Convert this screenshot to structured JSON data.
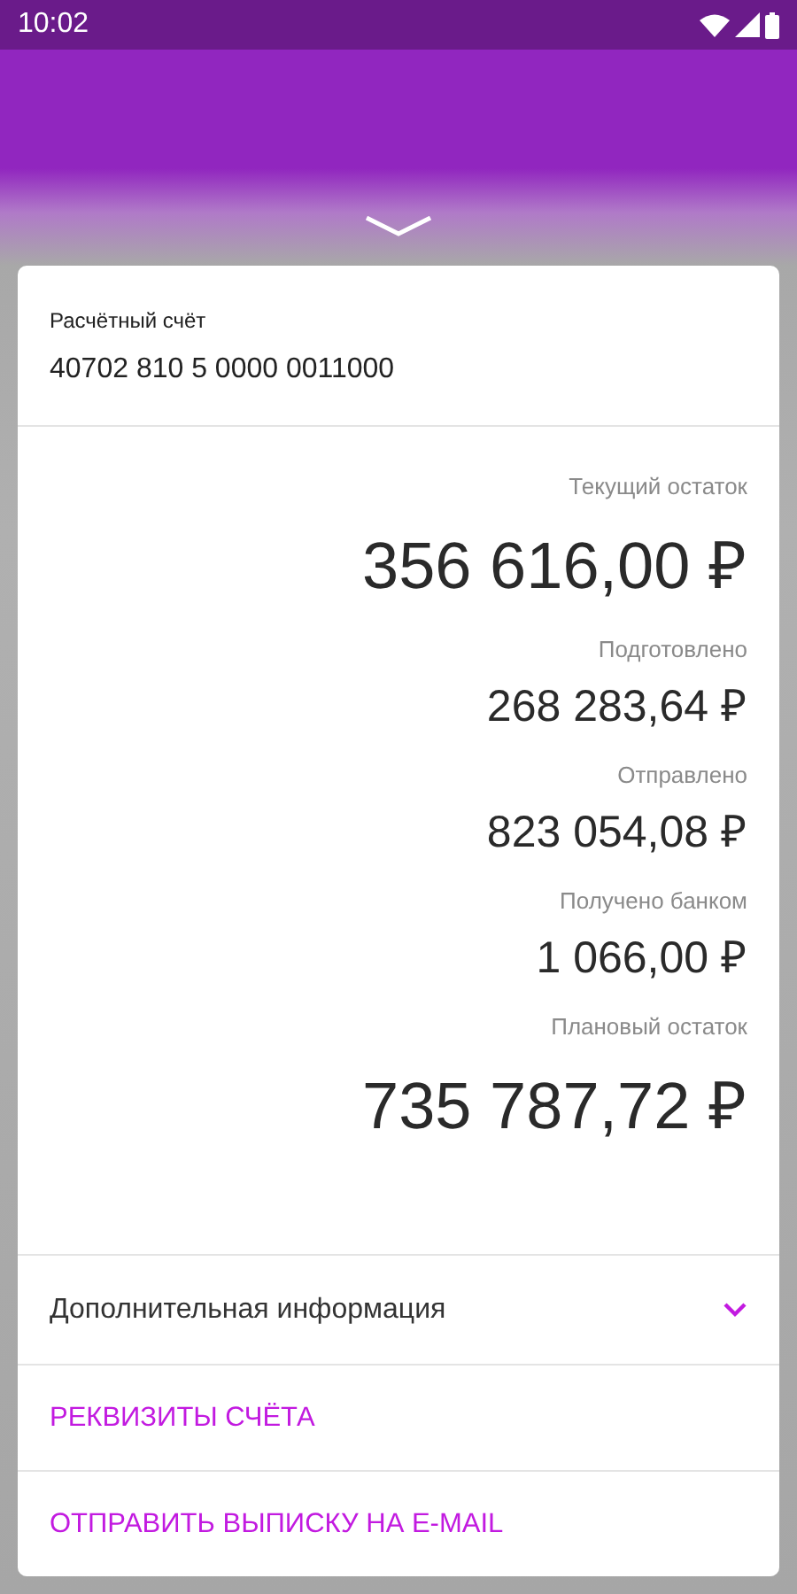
{
  "status_bar": {
    "time": "10:02"
  },
  "account": {
    "label": "Расчётный счёт",
    "number": "40702 810 5 0000 0011000"
  },
  "balances": [
    {
      "kind": "primary",
      "label": "Текущий остаток",
      "amount": "356 616,00 ₽"
    },
    {
      "kind": "secondary",
      "label": "Подготовлено",
      "amount": "268 283,64 ₽"
    },
    {
      "kind": "secondary",
      "label": "Отправлено",
      "amount": "823 054,08 ₽"
    },
    {
      "kind": "secondary",
      "label": "Получено банком",
      "amount": "1 066,00 ₽"
    },
    {
      "kind": "primary",
      "label": "Плановый остаток",
      "amount": "735 787,72 ₽"
    }
  ],
  "details": {
    "label": "Дополнительная информация",
    "expanded": false
  },
  "actions": [
    "РЕКВИЗИТЫ СЧЁТА",
    "ОТПРАВИТЬ ВЫПИСКУ НА E-MAIL"
  ]
}
